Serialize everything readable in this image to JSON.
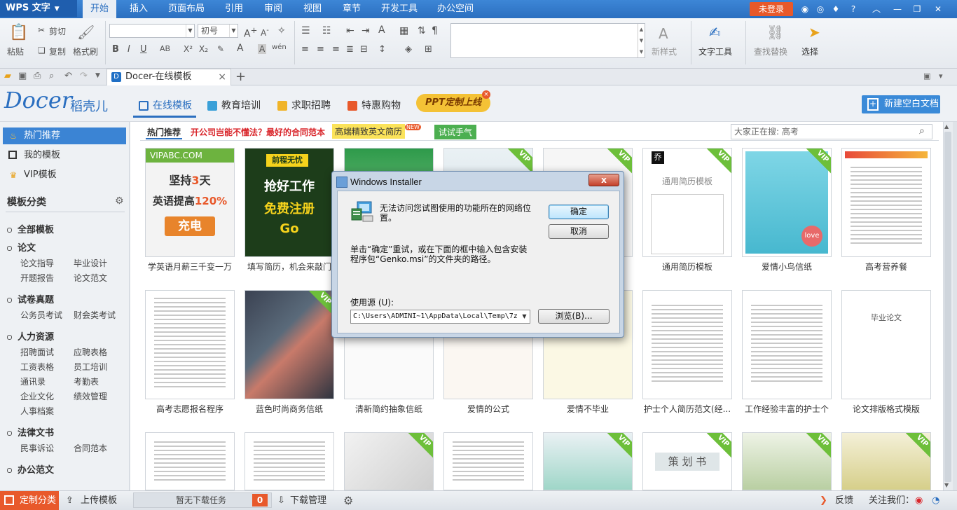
{
  "app": {
    "logo": "WPS 文字",
    "logo_arrow": "▼",
    "login": "未登录",
    "help": "?"
  },
  "menu": [
    "开始",
    "插入",
    "页面布局",
    "引用",
    "审阅",
    "视图",
    "章节",
    "开发工具",
    "办公空间"
  ],
  "ribbon": {
    "paste": "粘贴",
    "cut": "剪切",
    "copy": "复制",
    "format_painter": "格式刷",
    "font_size": "初号",
    "styles": "新样式",
    "text_tools": "文字工具",
    "find_replace": "查找替换",
    "select": "选择",
    "bold": "B",
    "italic": "I",
    "underline": "U"
  },
  "tab": {
    "label": "Docer-在线模板",
    "close": "×",
    "add": "+"
  },
  "docer": {
    "logo": "Docer",
    "logo_cn": "稻壳儿",
    "nav": [
      "在线模板",
      "教育培训",
      "求职招聘",
      "特惠购物"
    ],
    "ppt_badge": "PPT定制上线",
    "new_doc": "新建空白文档"
  },
  "sidebar": {
    "items": [
      "热门推荐",
      "我的模板",
      "VIP模板"
    ],
    "category_title": "模板分类",
    "categories": [
      {
        "name": "全部模板",
        "subs": []
      },
      {
        "name": "论文",
        "subs": [
          "论文指导",
          "毕业设计",
          "开题报告",
          "论文范文"
        ]
      },
      {
        "name": "试卷真题",
        "subs": [
          "公务员考试",
          "财会类考试"
        ]
      },
      {
        "name": "人力资源",
        "subs": [
          "招聘面试",
          "应聘表格",
          "工资表格",
          "员工培训",
          "通讯录",
          "考勤表",
          "企业文化",
          "绩效管理",
          "人事档案"
        ]
      },
      {
        "name": "法律文书",
        "subs": [
          "民事诉讼",
          "合同范本"
        ]
      },
      {
        "name": "办公范文",
        "subs": []
      }
    ]
  },
  "main": {
    "hot_label": "热门推荐",
    "promo1": "开公司岂能不懂法？最好的合同范本",
    "promo2": "高端精致英文简历",
    "new_badge": "NEW",
    "promo3": "试试手气",
    "search_placeholder": "大家正在搜: 高考",
    "vip": "VIP",
    "ad1": {
      "top": "VIPABC.COM",
      "line1": "坚持",
      "num": "3",
      "line1b": "天",
      "line2": "英语提高",
      "pct": "120%",
      "btn": "充电"
    },
    "ad2": {
      "brand": "前程无忧",
      "text1": "抢好工作",
      "text2": "免费注册",
      "go": "Go"
    },
    "card_text": {
      "resume": "通用简历模板",
      "resume_mark": "乔",
      "love": "love",
      "plan": "策 划 书",
      "thesis": "毕业论文"
    },
    "row1": [
      "学英语月薪三千变一万",
      "填写简历，机会来敲门",
      "",
      "",
      "",
      "通用简历模板",
      "爱情小鸟信纸",
      "高考营养餐"
    ],
    "row2": [
      "高考志愿报名程序",
      "蓝色时尚商务信纸",
      "清新简约抽象信纸",
      "爱情的公式",
      "爱情不毕业",
      "护士个人简历范文(经...",
      "工作经验丰富的护士个",
      "论文排版格式模版"
    ]
  },
  "status": {
    "custom_cat": "定制分类",
    "upload": "上传模板",
    "no_download": "暂无下载任务",
    "count": "0",
    "download_mgr": "下载管理",
    "feedback": "反馈",
    "follow": "关注我们："
  },
  "dialog": {
    "title": "Windows Installer",
    "close": "x",
    "msg1": "无法访问您试图使用的功能所在的网络位置。",
    "msg2": "单击“确定”重试，或在下面的框中输入包含安装程序包“Genko.msi”的文件夹的路径。",
    "source_label": "使用源 (U):",
    "source_value": "C:\\Users\\ADMINI~1\\AppData\\Local\\Temp\\7z",
    "ok": "确定",
    "cancel": "取消",
    "browse": "浏览(B)..."
  },
  "colors": {
    "accent": "#2b6fc0",
    "orange": "#e8592b",
    "vip_green": "#6dbf3a"
  }
}
